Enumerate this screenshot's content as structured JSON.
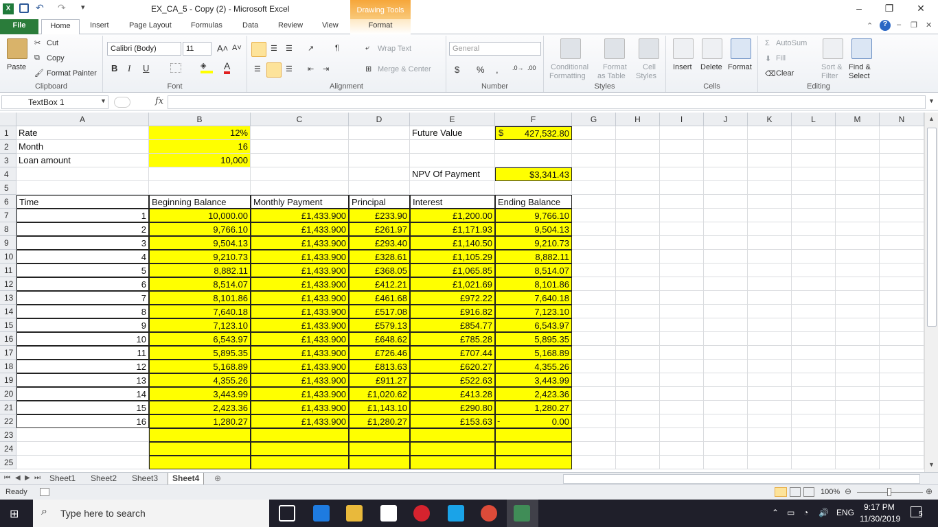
{
  "window": {
    "title": "EX_CA_5 - Copy (2)  -  Microsoft Excel",
    "contextual_tab_group": "Drawing Tools",
    "controls": [
      "–",
      "❐",
      "✕"
    ]
  },
  "tabs": [
    "File",
    "Home",
    "Insert",
    "Page Layout",
    "Formulas",
    "Data",
    "Review",
    "View",
    "Format"
  ],
  "ribbon": {
    "clipboard": {
      "label": "Clipboard",
      "paste": "Paste",
      "cut": "Cut",
      "copy": "Copy",
      "format_painter": "Format Painter"
    },
    "font": {
      "label": "Font",
      "font_name": "Calibri (Body)",
      "font_size": "11",
      "bold": "B",
      "italic": "I",
      "underline": "U"
    },
    "alignment": {
      "label": "Alignment",
      "wrap_text": "Wrap Text",
      "merge_center": "Merge & Center"
    },
    "number": {
      "label": "Number",
      "format": "General",
      "currency": "$",
      "percent": "%",
      "comma": ","
    },
    "styles": {
      "label": "Styles",
      "conditional": "Conditional",
      "conditional2": "Formatting",
      "format_table": "Format",
      "format_table2": "as Table",
      "cell_styles": "Cell",
      "cell_styles2": "Styles"
    },
    "cells": {
      "label": "Cells",
      "insert": "Insert",
      "delete": "Delete",
      "format": "Format"
    },
    "editing": {
      "label": "Editing",
      "autosum": "AutoSum",
      "fill": "Fill",
      "clear": "Clear",
      "sort": "Sort &",
      "sort2": "Filter",
      "find": "Find &",
      "find2": "Select"
    }
  },
  "formula_bar": {
    "name_box": "TextBox 1",
    "fx": "fx",
    "value": ""
  },
  "columns": [
    "A",
    "B",
    "C",
    "D",
    "E",
    "F",
    "G",
    "H",
    "I",
    "J",
    "K",
    "L",
    "M",
    "N"
  ],
  "rows": [
    "1",
    "2",
    "3",
    "4",
    "5",
    "6",
    "7",
    "8",
    "9",
    "10",
    "11",
    "12",
    "13",
    "14",
    "15",
    "16",
    "17",
    "18",
    "19",
    "20",
    "21",
    "22",
    "23",
    "24",
    "25"
  ],
  "sheet": {
    "A1": "Rate",
    "B1": "12%",
    "A2": "Month",
    "B2": "16",
    "A3": "Loan amount",
    "B3": "10,000",
    "E1": "Future Value",
    "F1_currency": "$",
    "F1": "427,532.80",
    "E4": "NPV Of Payment",
    "F4": "$3,341.43",
    "headers": [
      "Time",
      "Beginning Balance",
      "Monthly Payment",
      "Principal",
      "Interest",
      "Ending Balance"
    ],
    "table": [
      [
        "1",
        "10,000.00",
        "£1,433.900",
        "£233.90",
        "£1,200.00",
        "9,766.10"
      ],
      [
        "2",
        "9,766.10",
        "£1,433.900",
        "£261.97",
        "£1,171.93",
        "9,504.13"
      ],
      [
        "3",
        "9,504.13",
        "£1,433.900",
        "£293.40",
        "£1,140.50",
        "9,210.73"
      ],
      [
        "4",
        "9,210.73",
        "£1,433.900",
        "£328.61",
        "£1,105.29",
        "8,882.11"
      ],
      [
        "5",
        "8,882.11",
        "£1,433.900",
        "£368.05",
        "£1,065.85",
        "8,514.07"
      ],
      [
        "6",
        "8,514.07",
        "£1,433.900",
        "£412.21",
        "£1,021.69",
        "8,101.86"
      ],
      [
        "7",
        "8,101.86",
        "£1,433.900",
        "£461.68",
        "£972.22",
        "7,640.18"
      ],
      [
        "8",
        "7,640.18",
        "£1,433.900",
        "£517.08",
        "£916.82",
        "7,123.10"
      ],
      [
        "9",
        "7,123.10",
        "£1,433.900",
        "£579.13",
        "£854.77",
        "6,543.97"
      ],
      [
        "10",
        "6,543.97",
        "£1,433.900",
        "£648.62",
        "£785.28",
        "5,895.35"
      ],
      [
        "11",
        "5,895.35",
        "£1,433.900",
        "£726.46",
        "£707.44",
        "5,168.89"
      ],
      [
        "12",
        "5,168.89",
        "£1,433.900",
        "£813.63",
        "£620.27",
        "4,355.26"
      ],
      [
        "13",
        "4,355.26",
        "£1,433.900",
        "£911.27",
        "£522.63",
        "3,443.99"
      ],
      [
        "14",
        "3,443.99",
        "£1,433.900",
        "£1,020.62",
        "£413.28",
        "2,423.36"
      ],
      [
        "15",
        "2,423.36",
        "£1,433.900",
        "£1,143.10",
        "£290.80",
        "1,280.27"
      ],
      [
        "16",
        "1,280.27",
        "£1,433.900",
        "£1,280.27",
        "£153.63",
        "0.00"
      ]
    ],
    "F22_prefix": "-"
  },
  "sheet_tabs": [
    "Sheet1",
    "Sheet2",
    "Sheet3",
    "Sheet4"
  ],
  "active_sheet": "Sheet4",
  "status": {
    "ready": "Ready",
    "zoom": "100%"
  },
  "taskbar": {
    "search": "Type here to search",
    "lang": "ENG",
    "time": "9:17 PM",
    "date": "11/30/2019",
    "notifications": "5"
  },
  "colors": {
    "highlight": "#ffff00",
    "file_tab": "#2a7c3a",
    "drawing_tools": "#f6a63a"
  }
}
